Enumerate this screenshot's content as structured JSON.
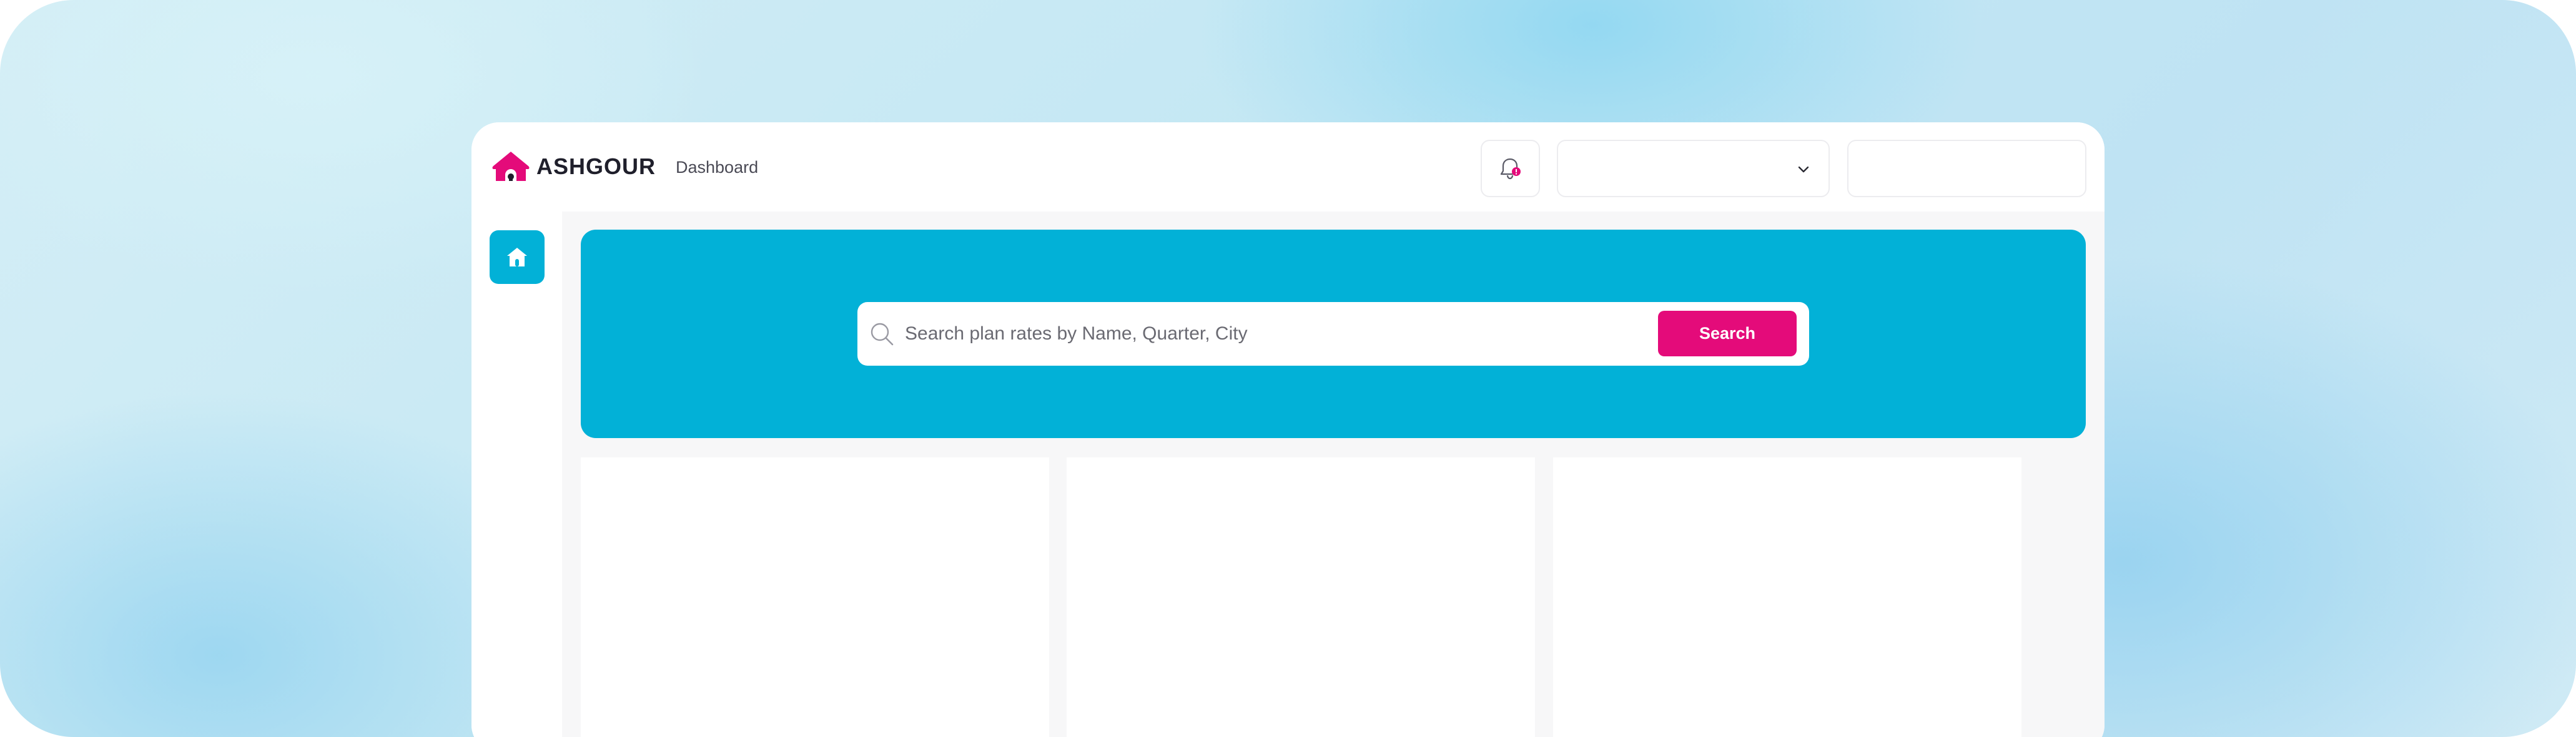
{
  "header": {
    "logo_text": "ASHGOUR",
    "nav_dashboard": "Dashboard",
    "notification_icon": "bell-icon",
    "select_icon": "chevron-down-icon"
  },
  "sidebar": {
    "items": [
      {
        "icon": "home-icon",
        "active": true
      }
    ]
  },
  "search": {
    "placeholder": "Search plan rates by Name, Quarter, City",
    "button_label": "Search",
    "icon": "search-icon"
  },
  "colors": {
    "brand_pink": "#e40b7a",
    "brand_cyan": "#02b1d7",
    "text_dark": "#1f1f2b"
  }
}
